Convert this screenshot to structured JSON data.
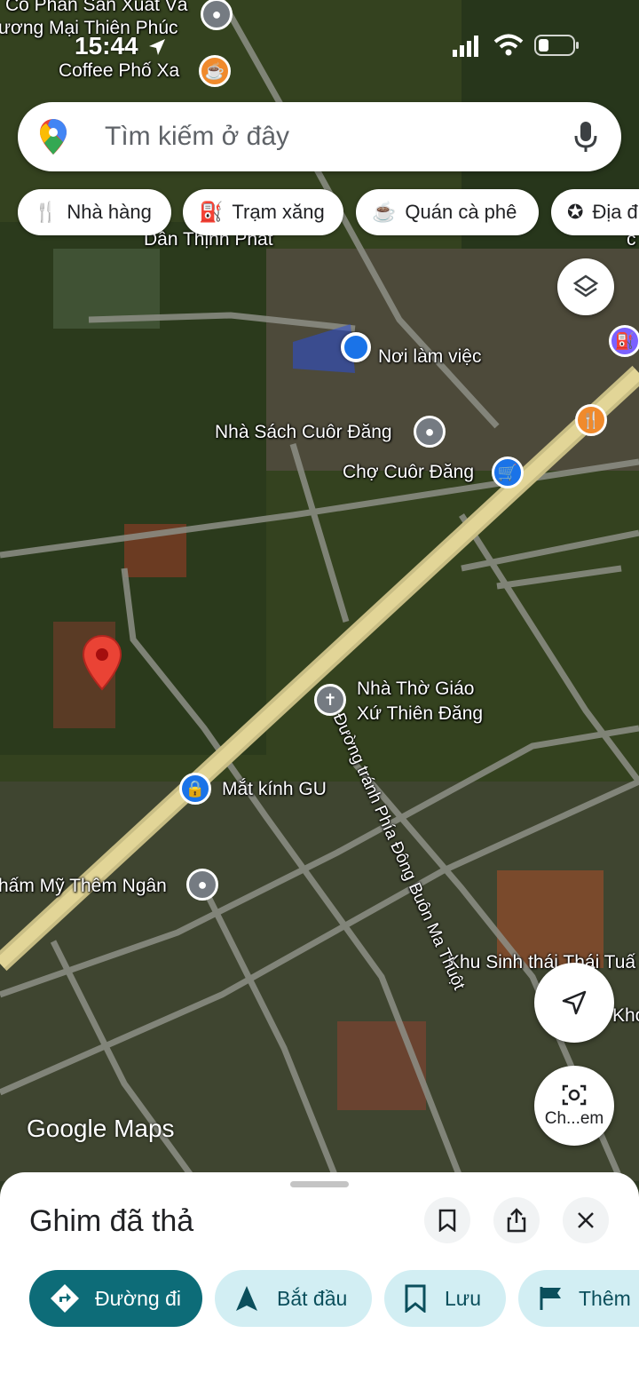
{
  "status": {
    "time": "15:44"
  },
  "search": {
    "placeholder": "Tìm kiếm ở đây"
  },
  "chips": [
    {
      "icon": "restaurant-icon",
      "label": "Nhà hàng"
    },
    {
      "icon": "gas-station-icon",
      "label": "Trạm xăng"
    },
    {
      "icon": "coffee-icon",
      "label": "Quán cà phê"
    },
    {
      "icon": "attractions-icon",
      "label": "Địa đ"
    }
  ],
  "map": {
    "labels": {
      "top1": "Cổ Phần Sản Xuất Và",
      "top2": "ương Mại Thiên Phúc",
      "coffee": "Coffee Phố Xa",
      "thinh_phat": "Dân Thịnh Phát",
      "workplace": "Nơi làm việc",
      "bookstore": "Nhà Sách Cuôr Đăng",
      "market": "Chợ Cuôr Đăng",
      "church1": "Nhà Thờ Giáo",
      "church2": "Xứ Thiên Đăng",
      "glasses": "Mắt kính GU",
      "spa": "hấm Mỹ Thêm Ngân",
      "eco": "Khu Sinh thái Thái Tuấ",
      "kho": "Khơ",
      "road": "Đường tránh Phía Đông Buôn Ma Thuột",
      "google": "Google Maps",
      "partial_right": "c"
    },
    "lens_label": "Ch...em"
  },
  "sheet": {
    "title": "Ghim đã thả",
    "actions": [
      {
        "label": "Đường đi",
        "primary": true
      },
      {
        "label": "Bắt đầu"
      },
      {
        "label": "Lưu"
      },
      {
        "label": "Thêm"
      }
    ]
  },
  "colors": {
    "accent": "#0b7285",
    "pin": "#ea4335",
    "light_chip": "#d2eef3",
    "primary_chip": "#0d6c78"
  }
}
